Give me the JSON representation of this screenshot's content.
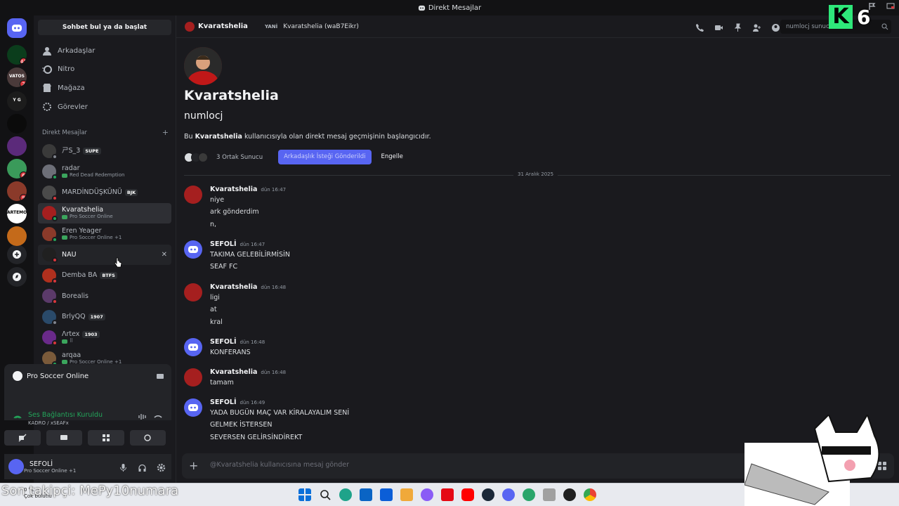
{
  "window": {
    "title": "Direkt Mesajlar"
  },
  "servers": [
    {
      "badge": "41",
      "color": "#0b3d1c"
    },
    {
      "badge": "2",
      "color": "#4a3a3a",
      "label": "VATOS"
    },
    {
      "badge": "",
      "color": "#1c1c1c",
      "label": "Y G"
    },
    {
      "badge": "",
      "color": "#0b0b0b"
    },
    {
      "badge": "",
      "color": "#5b2a7a"
    },
    {
      "badge": "6",
      "color": "#3a9a5a"
    },
    {
      "badge": "9",
      "color": "#8a3a2a"
    },
    {
      "badge": "",
      "color": "#ffffff",
      "label": "ARTEMON"
    },
    {
      "badge": "",
      "color": "#c46a1a"
    }
  ],
  "dm_column": {
    "search_label": "Sohbet bul ya da başlat",
    "nav": [
      {
        "label": "Arkadaşlar",
        "icon": "friends-icon"
      },
      {
        "label": "Nitro",
        "icon": "nitro-icon"
      },
      {
        "label": "Mağaza",
        "icon": "shop-icon"
      },
      {
        "label": "Görevler",
        "icon": "quests-icon"
      }
    ],
    "header": "Direkt Mesajlar",
    "add": "+",
    "dms": [
      {
        "name": "ㄕS_3",
        "tag": "SUPE",
        "sub": "",
        "status": "#80848e",
        "avcolor": "#3a3a3a"
      },
      {
        "name": "radar",
        "tag": "",
        "sub": "Red Dead Redemption",
        "status": "#23a55a",
        "avcolor": "#6d6f78"
      },
      {
        "name": "MARDİNDÜŞKÜNÜ",
        "tag": "BJK",
        "sub": "",
        "status": "#da373c",
        "avcolor": "#4a4a4a"
      },
      {
        "name": "Kvaratshelia",
        "tag": "",
        "sub": "Pro Soccer Online",
        "status": "#23a55a",
        "avcolor": "#a51f1f",
        "selected": true
      },
      {
        "name": "Eren Yeager",
        "tag": "",
        "sub": "Pro Soccer Online +1",
        "status": "#23a55a",
        "avcolor": "#8a3a2a"
      },
      {
        "name": "NAU",
        "tag": "",
        "sub": "",
        "status": "#da373c",
        "avcolor": "#202020",
        "hover": true
      },
      {
        "name": "Demba BA",
        "tag": "BTFS",
        "sub": "",
        "status": "#da373c",
        "avcolor": "#b0301e"
      },
      {
        "name": "Borealis",
        "tag": "",
        "sub": "",
        "status": "#da373c",
        "avcolor": "#5b3a6a"
      },
      {
        "name": "BrlyQQ",
        "tag": "1907",
        "sub": "",
        "status": "#80848e",
        "avcolor": "#2a4a6a"
      },
      {
        "name": "Λrtex",
        "tag": "1903",
        "sub": "⠿",
        "status": "#da373c",
        "avcolor": "#6a2a8a"
      },
      {
        "name": "arqaa",
        "tag": "",
        "sub": "Pro Soccer Online +1",
        "status": "#23a55a",
        "avcolor": "#7a5a3a"
      },
      {
        "name": "Umut",
        "tag": "",
        "sub": "",
        "status": "#23a55a",
        "avcolor": "#5a5a5a"
      }
    ]
  },
  "activity": {
    "game": "Pro Soccer Online",
    "voice_status": "Ses Bağlantısı Kuruldu",
    "voice_channel": "KADRO / xSEAFx"
  },
  "user": {
    "name": "SEFOLİ",
    "status": "Pro Soccer Online +1"
  },
  "topbar": {
    "name": "Kvaratshelia",
    "yani": "YANİ",
    "handle": "Kvaratshelia (waB7Eikr)",
    "search_placeholder": "numlocj sunucusu"
  },
  "intro": {
    "name": "Kvaratshelia",
    "username": "numlocj",
    "text_pre": "Bu ",
    "text_bold": "Kvaratshelia",
    "text_post": " kullanıcısıyla olan direkt mesaj geçmişinin başlangıcıdır.",
    "mutual": "3 Ortak Sunucu",
    "friend_btn": "Arkadaşlık İsteği Gönderildi",
    "block_btn": "Engelle"
  },
  "date_divider": "31 Aralık 2025",
  "messages": [
    {
      "author": "Kvaratshelia",
      "time": "dün 16:47",
      "lines": [
        "niye",
        "ark gönderdim",
        "n,"
      ],
      "avcolor": "#a51f1f",
      "discord": false
    },
    {
      "author": "SEFOLİ",
      "time": "dün 16:47",
      "lines": [
        "TAKIMA GELEBİLİRMİSİN",
        "SEAF FC"
      ],
      "avcolor": "#5865f2",
      "discord": true
    },
    {
      "author": "Kvaratshelia",
      "time": "dün 16:48",
      "lines": [
        "ligi",
        "at",
        "kral"
      ],
      "avcolor": "#a51f1f",
      "discord": false
    },
    {
      "author": "SEFOLİ",
      "time": "dün 16:48",
      "lines": [
        "KONFERANS"
      ],
      "avcolor": "#5865f2",
      "discord": true
    },
    {
      "author": "Kvaratshelia",
      "time": "dün 16:48",
      "lines": [
        "tamam"
      ],
      "avcolor": "#a51f1f",
      "discord": false
    },
    {
      "author": "SEFOLİ",
      "time": "dün 16:49",
      "lines": [
        "YADA BUGÜN MAÇ VAR KİRALAYALIM SENİ",
        "GELMEK İSTERSEN",
        "SEVERSEN GELİRSİNDİREKT"
      ],
      "avcolor": "#5865f2",
      "discord": true
    }
  ],
  "composer": {
    "placeholder": "@Kvaratshelia kullanıcısına mesaj gönder"
  },
  "taskbar": {
    "temp": "0 °C",
    "weather": "Çok bulutlu"
  },
  "overlay": {
    "text": "Son takipçi: MePy10numara",
    "counter_letter": "K",
    "counter_num": "6"
  }
}
